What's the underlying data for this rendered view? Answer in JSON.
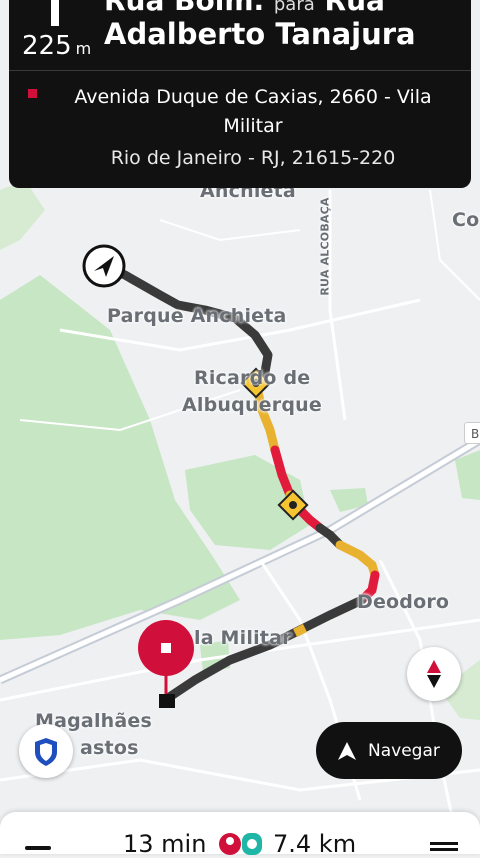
{
  "banner": {
    "distance_value": "225",
    "distance_unit": "m",
    "street_from": "Rua Bolm.",
    "connector": "para",
    "street_from_2": "Rua",
    "street_to": "Adalberto Tanajura",
    "destination_address": "Avenida Duque de Caxias, 2660 - Vila Militar",
    "destination_city": "Rio de Janeiro - RJ, 21615-220"
  },
  "map": {
    "labels": {
      "anchieta": "Anchieta",
      "parque_anchieta": "Parque Anchieta",
      "ricardo_1": "Ricardo de",
      "ricardo_2": "Albuquerque",
      "deodoro": "Deodoro",
      "vila_militar": "la Militar",
      "magalhaes_1": "Magalhães",
      "magalhaes_2": "astos",
      "rua_alcobaca": "RUA ALCOBAÇA",
      "co": "Co",
      "b": "B"
    },
    "route_colors": {
      "normal": "#3a3a3a",
      "moderate": "#e8b230",
      "heavy": "#e01b3c"
    }
  },
  "controls": {
    "navigate_label": "Navegar"
  },
  "trip": {
    "eta": "13 min",
    "distance": "7.4 km"
  }
}
